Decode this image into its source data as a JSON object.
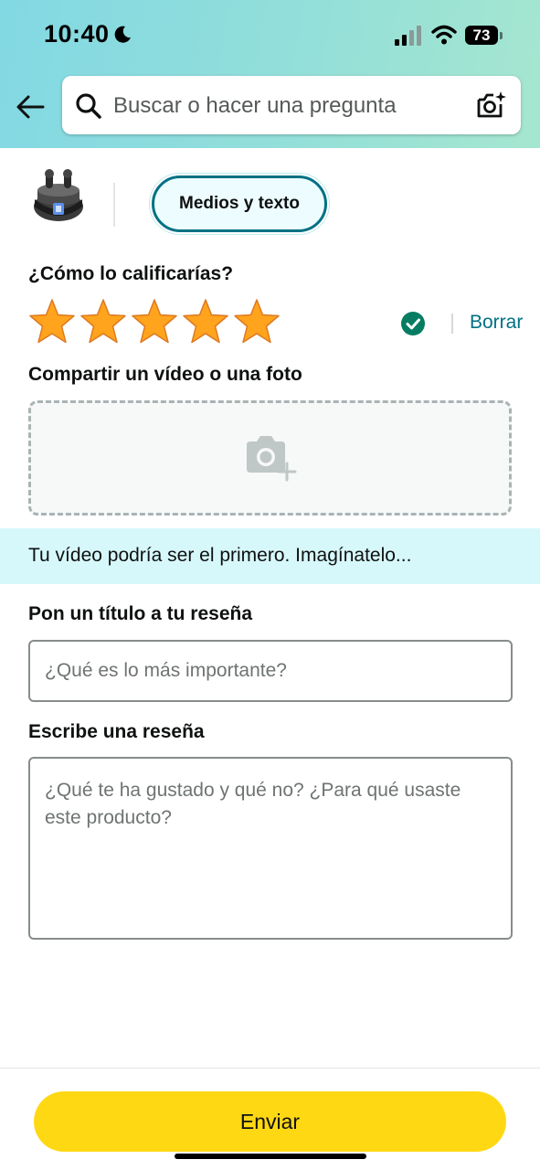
{
  "status_bar": {
    "time": "10:40",
    "battery": "73"
  },
  "search": {
    "placeholder": "Buscar o hacer una pregunta"
  },
  "review": {
    "mode_chip": "Medios y texto",
    "rating_label": "¿Cómo lo calificarías?",
    "rating": 5,
    "rating_max": 5,
    "clear_label": "Borrar",
    "media_label": "Compartir un vídeo o una foto",
    "banner_text": "Tu vídeo podría ser el primero. Imagínatelo...",
    "title_label": "Pon un título a tu reseña",
    "title_placeholder": "¿Qué es lo más importante?",
    "body_label": "Escribe una reseña",
    "body_placeholder": "¿Qué te ha gustado y qué no? ¿Para qué usaste este producto?",
    "submit_label": "Enviar"
  },
  "colors": {
    "header_gradient_start": "#82d8e3",
    "header_gradient_end": "#a5e6cf",
    "star": "#ffa41c",
    "link": "#007185",
    "check": "#067d62",
    "button": "#ffd814",
    "banner": "#d7f8fb"
  },
  "icons": [
    "moon-icon",
    "signal-icon",
    "wifi-icon",
    "back-arrow-icon",
    "search-icon",
    "camera-search-icon",
    "star-icon",
    "check-circle-icon",
    "camera-plus-icon"
  ]
}
